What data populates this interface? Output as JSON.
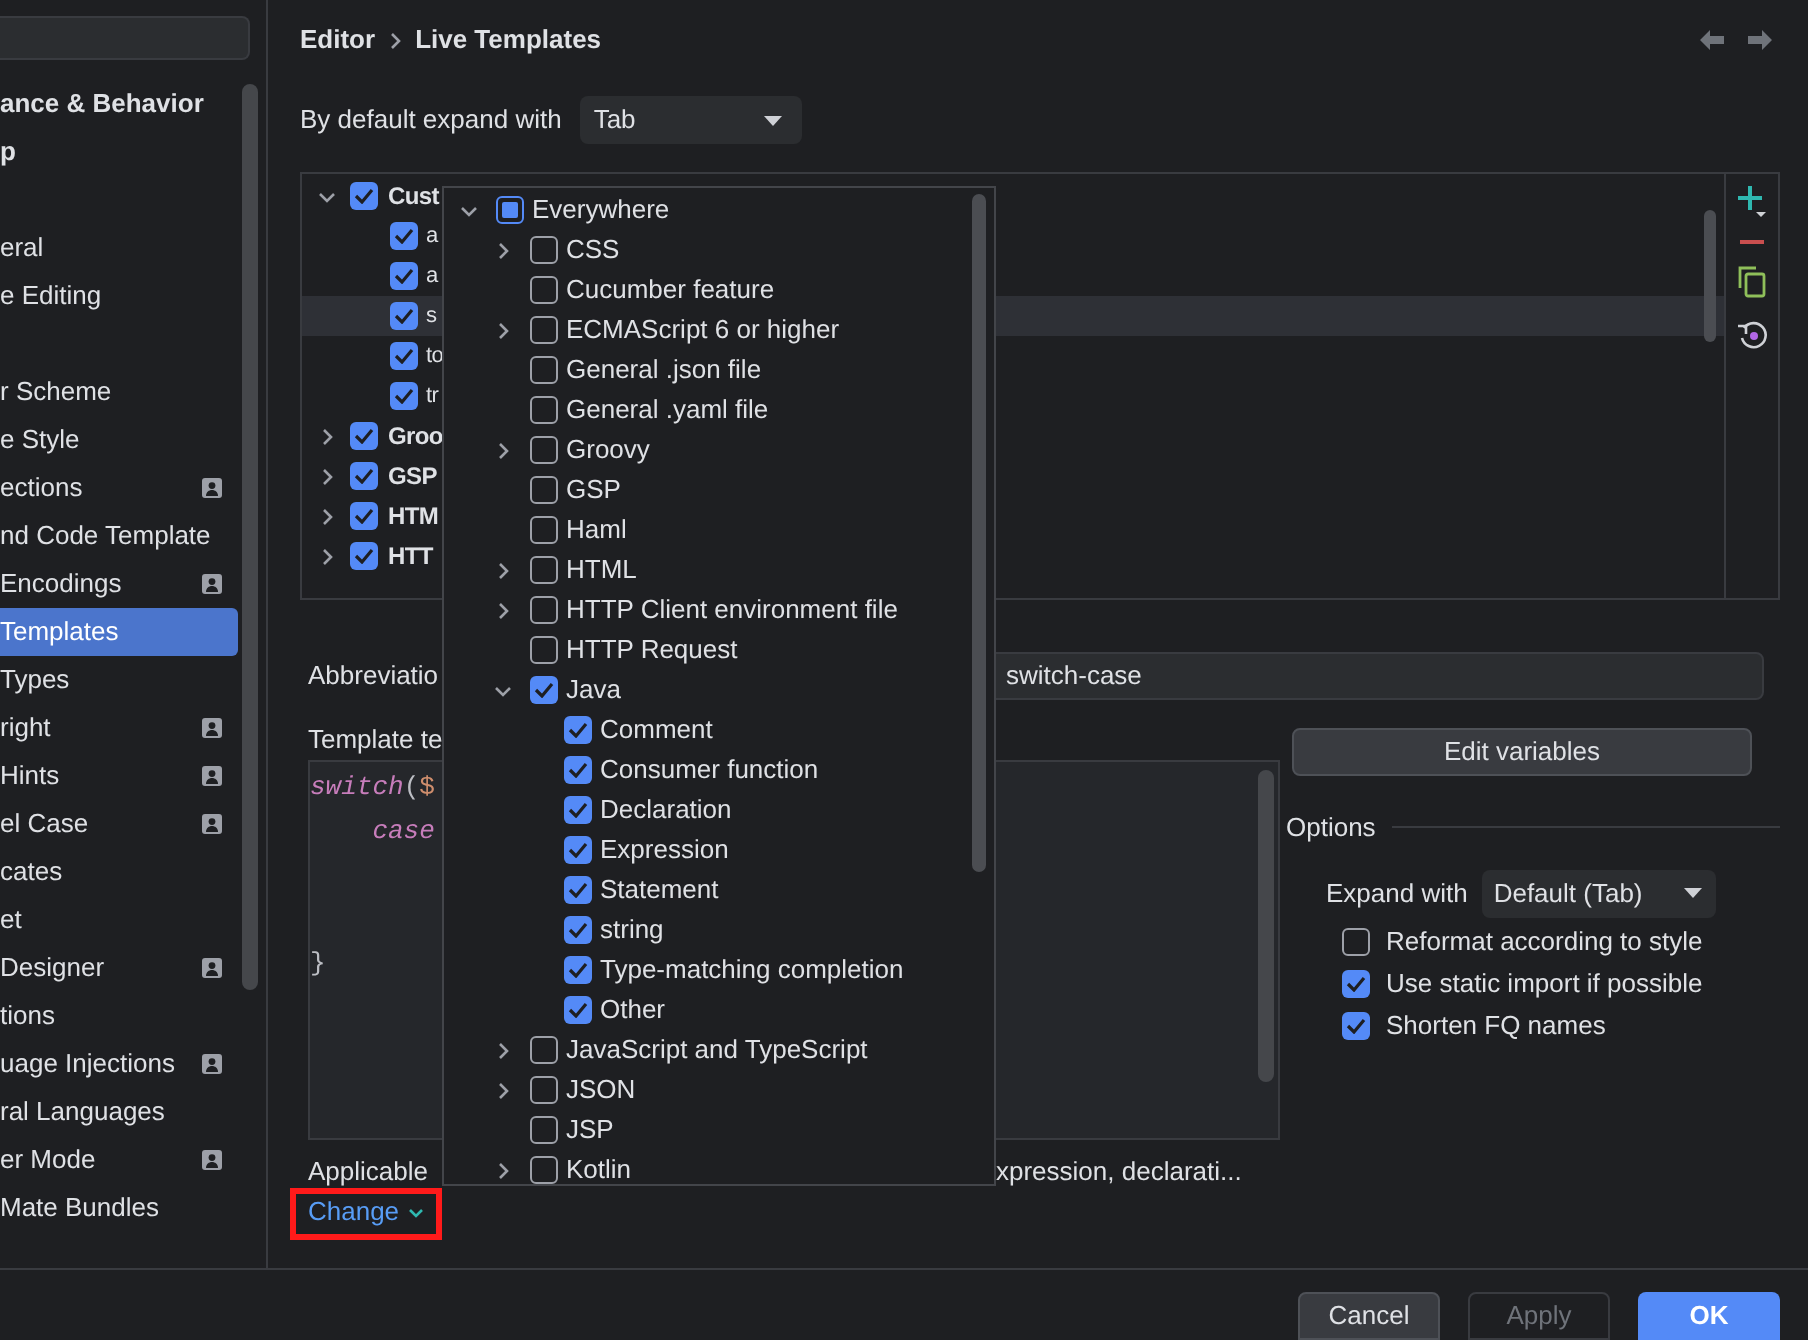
{
  "sidebar": {
    "groups": [
      {
        "items": [
          {
            "label": "ance & Behavior",
            "bold": true,
            "selected": false,
            "badge": false
          },
          {
            "label": "p",
            "bold": true,
            "selected": false,
            "badge": false
          }
        ]
      },
      {
        "items": [
          {
            "label": "eral",
            "bold": false,
            "selected": false,
            "badge": false
          },
          {
            "label": "e Editing",
            "bold": false,
            "selected": false,
            "badge": false
          }
        ]
      },
      {
        "items": [
          {
            "label": "r Scheme",
            "bold": false,
            "selected": false,
            "badge": false
          },
          {
            "label": "e Style",
            "bold": false,
            "selected": false,
            "badge": false
          },
          {
            "label": "ections",
            "bold": false,
            "selected": false,
            "badge": true
          },
          {
            "label": "nd Code Template",
            "bold": false,
            "selected": false,
            "badge": false
          },
          {
            "label": "Encodings",
            "bold": false,
            "selected": false,
            "badge": true
          },
          {
            "label": "Templates",
            "bold": false,
            "selected": true,
            "badge": false
          },
          {
            "label": "Types",
            "bold": false,
            "selected": false,
            "badge": false
          },
          {
            "label": "right",
            "bold": false,
            "selected": false,
            "badge": true
          },
          {
            "label": "Hints",
            "bold": false,
            "selected": false,
            "badge": true
          },
          {
            "label": "el Case",
            "bold": false,
            "selected": false,
            "badge": true
          },
          {
            "label": "cates",
            "bold": false,
            "selected": false,
            "badge": false
          },
          {
            "label": "et",
            "bold": false,
            "selected": false,
            "badge": false
          },
          {
            "label": "Designer",
            "bold": false,
            "selected": false,
            "badge": true
          },
          {
            "label": "tions",
            "bold": false,
            "selected": false,
            "badge": false
          },
          {
            "label": "uage Injections",
            "bold": false,
            "selected": false,
            "badge": true
          },
          {
            "label": "ral Languages",
            "bold": false,
            "selected": false,
            "badge": false
          },
          {
            "label": "er Mode",
            "bold": false,
            "selected": false,
            "badge": true
          },
          {
            "label": "Mate Bundles",
            "bold": false,
            "selected": false,
            "badge": false
          }
        ]
      }
    ]
  },
  "breadcrumb": [
    "Editor",
    "Live Templates"
  ],
  "expand_default": {
    "label": "By default expand with",
    "value": "Tab"
  },
  "templates_tree": {
    "rows": [
      {
        "label": "Cust",
        "checked": true,
        "expanded": true,
        "selected": false,
        "children": [
          {
            "label": "a",
            "checked": true,
            "selected": false
          },
          {
            "label": "a",
            "checked": true,
            "selected": false
          },
          {
            "label": "s",
            "checked": true,
            "selected": true
          },
          {
            "label": "to",
            "checked": true,
            "selected": false
          },
          {
            "label": "tr",
            "checked": true,
            "selected": false
          }
        ]
      },
      {
        "label": "Groo",
        "checked": true,
        "expanded": false,
        "selected": false
      },
      {
        "label": "GSP",
        "checked": true,
        "expanded": false,
        "selected": false
      },
      {
        "label": "HTM",
        "checked": true,
        "expanded": false,
        "selected": false
      },
      {
        "label": "HTT",
        "checked": true,
        "expanded": false,
        "selected": false
      }
    ]
  },
  "abbreviation": {
    "label": "Abbreviatio",
    "value": "switch-case"
  },
  "template_text": {
    "label": "Template te",
    "lines": [
      [
        {
          "text": "switch",
          "kind": "keyword"
        },
        {
          "text": "(",
          "kind": "plain"
        },
        {
          "text": "$",
          "kind": "variable"
        }
      ],
      [
        {
          "text": "    case",
          "kind": "keyword"
        }
      ],
      [
        {
          "text": "}",
          "kind": "plain"
        }
      ]
    ]
  },
  "applicable": {
    "label": "Applicable",
    "context": "xpression, declarati...",
    "change_link": {
      "label": "Change",
      "highlighted": true
    }
  },
  "edit_variables": "Edit variables",
  "options": {
    "title": "Options",
    "expand_with": {
      "label": "Expand with",
      "value": "Default (Tab)"
    },
    "checkboxes": [
      {
        "label": "Reformat according to style",
        "checked": false
      },
      {
        "label": "Use static import if possible",
        "checked": true
      },
      {
        "label": "Shorten FQ names",
        "checked": true
      }
    ]
  },
  "context_popup": {
    "rows": [
      {
        "label": "Everywhere",
        "indeterminate": true,
        "expanded": true,
        "children": [
          {
            "label": "CSS",
            "checked": false,
            "expanded": false
          },
          {
            "label": "Cucumber feature",
            "checked": false
          },
          {
            "label": "ECMAScript 6 or higher",
            "checked": false,
            "expanded": false
          },
          {
            "label": "General .json file",
            "checked": false
          },
          {
            "label": "General .yaml file",
            "checked": false
          },
          {
            "label": "Groovy",
            "checked": false,
            "expanded": false
          },
          {
            "label": "GSP",
            "checked": false
          },
          {
            "label": "Haml",
            "checked": false
          },
          {
            "label": "HTML",
            "checked": false,
            "expanded": false
          },
          {
            "label": "HTTP Client environment file",
            "checked": false,
            "expanded": false
          },
          {
            "label": "HTTP Request",
            "checked": false
          },
          {
            "label": "Java",
            "checked": true,
            "expanded": true,
            "children": [
              {
                "label": "Comment",
                "checked": true
              },
              {
                "label": "Consumer function",
                "checked": true
              },
              {
                "label": "Declaration",
                "checked": true
              },
              {
                "label": "Expression",
                "checked": true
              },
              {
                "label": "Statement",
                "checked": true
              },
              {
                "label": "string",
                "checked": true
              },
              {
                "label": "Type-matching completion",
                "checked": true
              },
              {
                "label": "Other",
                "checked": true
              }
            ]
          },
          {
            "label": "JavaScript and TypeScript",
            "checked": false,
            "expanded": false
          },
          {
            "label": "JSON",
            "checked": false,
            "expanded": false
          },
          {
            "label": "JSP",
            "checked": false
          },
          {
            "label": "Kotlin",
            "checked": false,
            "expanded": false
          }
        ]
      }
    ]
  },
  "footer": {
    "buttons": [
      {
        "label": "Cancel",
        "kind": "secondary"
      },
      {
        "label": "Apply",
        "kind": "disabled"
      },
      {
        "label": "OK",
        "kind": "primary"
      }
    ]
  }
}
